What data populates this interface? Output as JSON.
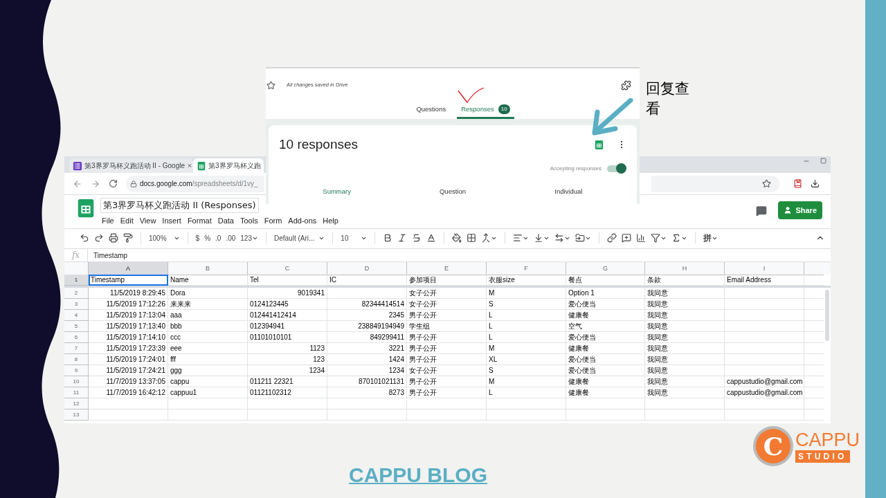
{
  "browser": {
    "tabs": [
      {
        "label": "第3界罗马杯义跑活动 II - Google",
        "kind": "forms",
        "selected": false
      },
      {
        "label": "第3界罗马杯义跑",
        "kind": "sheets",
        "selected": true
      }
    ],
    "url_host": "docs.google.com",
    "url_path": "/spreadsheets/d/1vy_"
  },
  "sheet": {
    "title": "第3界罗马杯义跑活动 II (Responses)",
    "menu": [
      "File",
      "Edit",
      "View",
      "Insert",
      "Format",
      "Data",
      "Tools",
      "Form",
      "Add-ons",
      "Help"
    ],
    "share_label": "Share",
    "toolbar": {
      "zoom": "100%",
      "currency": "$",
      "percent": "%",
      "decrease_decimals": ".0",
      "increase_decimals": ".00",
      "more_formats": "123",
      "font": "Default (Ari...",
      "font_size": "10",
      "input_tools": "拼"
    },
    "formula": {
      "fx": "fx",
      "value": "Timestamp"
    },
    "columns": [
      {
        "letter": "A",
        "selected": true
      },
      {
        "letter": "B",
        "selected": false
      },
      {
        "letter": "C",
        "selected": false
      },
      {
        "letter": "D",
        "selected": false
      },
      {
        "letter": "E",
        "selected": false
      },
      {
        "letter": "F",
        "selected": false
      },
      {
        "letter": "G",
        "selected": false
      },
      {
        "letter": "H",
        "selected": false
      },
      {
        "letter": "I",
        "selected": false
      }
    ],
    "rows": [
      {
        "number": "1",
        "selected": true,
        "cells": [
          {
            "text": "Timestamp",
            "right_aligned": false
          },
          {
            "text": "Name",
            "right_aligned": false
          },
          {
            "text": "Tel",
            "right_aligned": false
          },
          {
            "text": "IC",
            "right_aligned": false
          },
          {
            "text": "参加项目",
            "right_aligned": false
          },
          {
            "text": "衣服size",
            "right_aligned": false
          },
          {
            "text": "餐点",
            "right_aligned": false
          },
          {
            "text": "条款",
            "right_aligned": false
          },
          {
            "text": "Email Address",
            "right_aligned": false
          }
        ]
      },
      {
        "number": "2",
        "selected": false,
        "cells": [
          {
            "text": "11/5/2019 8:29:45",
            "right_aligned": true
          },
          {
            "text": "Dora",
            "right_aligned": false
          },
          {
            "text": "9019341",
            "right_aligned": true
          },
          null,
          {
            "text": "女子公开",
            "right_aligned": false
          },
          {
            "text": "M",
            "right_aligned": false
          },
          {
            "text": "Option 1",
            "right_aligned": false
          },
          {
            "text": "我同意",
            "right_aligned": false
          },
          null
        ]
      },
      {
        "number": "3",
        "selected": false,
        "cells": [
          {
            "text": "11/5/2019 17:12:26",
            "right_aligned": true
          },
          {
            "text": "来来来",
            "right_aligned": false
          },
          {
            "text": "0124123445",
            "right_aligned": false
          },
          {
            "text": "82344414514",
            "right_aligned": true
          },
          {
            "text": "女子公开",
            "right_aligned": false
          },
          {
            "text": "S",
            "right_aligned": false
          },
          {
            "text": "爱心便当",
            "right_aligned": false
          },
          {
            "text": "我同意",
            "right_aligned": false
          },
          null
        ]
      },
      {
        "number": "4",
        "selected": false,
        "cells": [
          {
            "text": "11/5/2019 17:13:04",
            "right_aligned": true
          },
          {
            "text": "aaa",
            "right_aligned": false
          },
          {
            "text": "012441412414",
            "right_aligned": false
          },
          {
            "text": "2345",
            "right_aligned": true
          },
          {
            "text": "男子公开",
            "right_aligned": false
          },
          {
            "text": "L",
            "right_aligned": false
          },
          {
            "text": "健康餐",
            "right_aligned": false
          },
          {
            "text": "我同意",
            "right_aligned": false
          },
          null
        ]
      },
      {
        "number": "5",
        "selected": false,
        "cells": [
          {
            "text": "11/5/2019 17:13:40",
            "right_aligned": true
          },
          {
            "text": "bbb",
            "right_aligned": false
          },
          {
            "text": "012394941",
            "right_aligned": false
          },
          {
            "text": "238849194949",
            "right_aligned": true
          },
          {
            "text": "学生组",
            "right_aligned": false
          },
          {
            "text": "L",
            "right_aligned": false
          },
          {
            "text": "空气",
            "right_aligned": false
          },
          {
            "text": "我同意",
            "right_aligned": false
          },
          null
        ]
      },
      {
        "number": "6",
        "selected": false,
        "cells": [
          {
            "text": "11/5/2019 17:14:10",
            "right_aligned": true
          },
          {
            "text": "ccc",
            "right_aligned": false
          },
          {
            "text": "01101010101",
            "right_aligned": false
          },
          {
            "text": "849299411",
            "right_aligned": true
          },
          {
            "text": "男子公开",
            "right_aligned": false
          },
          {
            "text": "L",
            "right_aligned": false
          },
          {
            "text": "爱心便当",
            "right_aligned": false
          },
          {
            "text": "我同意",
            "right_aligned": false
          },
          null
        ]
      },
      {
        "number": "7",
        "selected": false,
        "cells": [
          {
            "text": "11/5/2019 17:23:39",
            "right_aligned": true
          },
          {
            "text": "eee",
            "right_aligned": false
          },
          {
            "text": "1123",
            "right_aligned": true
          },
          {
            "text": "3221",
            "right_aligned": true
          },
          {
            "text": "男子公开",
            "right_aligned": false
          },
          {
            "text": "M",
            "right_aligned": false
          },
          {
            "text": "健康餐",
            "right_aligned": false
          },
          {
            "text": "我同意",
            "right_aligned": false
          },
          null
        ]
      },
      {
        "number": "8",
        "selected": false,
        "cells": [
          {
            "text": "11/5/2019 17:24:01",
            "right_aligned": true
          },
          {
            "text": "fff",
            "right_aligned": false
          },
          {
            "text": "123",
            "right_aligned": true
          },
          {
            "text": "1424",
            "right_aligned": true
          },
          {
            "text": "男子公开",
            "right_aligned": false
          },
          {
            "text": "XL",
            "right_aligned": false
          },
          {
            "text": "爱心便当",
            "right_aligned": false
          },
          {
            "text": "我同意",
            "right_aligned": false
          },
          null
        ]
      },
      {
        "number": "9",
        "selected": false,
        "cells": [
          {
            "text": "11/5/2019 17:24:21",
            "right_aligned": true
          },
          {
            "text": "ggg",
            "right_aligned": false
          },
          {
            "text": "1234",
            "right_aligned": true
          },
          {
            "text": "1234",
            "right_aligned": true
          },
          {
            "text": "女子公开",
            "right_aligned": false
          },
          {
            "text": "S",
            "right_aligned": false
          },
          {
            "text": "爱心便当",
            "right_aligned": false
          },
          {
            "text": "我同意",
            "right_aligned": false
          },
          null
        ]
      },
      {
        "number": "10",
        "selected": false,
        "cells": [
          {
            "text": "11/7/2019 13:37:05",
            "right_aligned": true
          },
          {
            "text": "cappu",
            "right_aligned": false
          },
          {
            "text": "011211 22321",
            "right_aligned": false
          },
          {
            "text": "870101021131",
            "right_aligned": true
          },
          {
            "text": "男子公开",
            "right_aligned": false
          },
          {
            "text": "M",
            "right_aligned": false
          },
          {
            "text": "健康餐",
            "right_aligned": false
          },
          {
            "text": "我同意",
            "right_aligned": false
          },
          {
            "text": "cappustudio@gmail.com",
            "right_aligned": false
          }
        ]
      },
      {
        "number": "11",
        "selected": false,
        "cells": [
          {
            "text": "11/7/2019 16:42:12",
            "right_aligned": true
          },
          {
            "text": "cappuu1",
            "right_aligned": false
          },
          {
            "text": "01121102312",
            "right_aligned": false
          },
          {
            "text": "8273",
            "right_aligned": true
          },
          {
            "text": "男子公开",
            "right_aligned": false
          },
          {
            "text": "L",
            "right_aligned": false
          },
          {
            "text": "健康餐",
            "right_aligned": false
          },
          {
            "text": "我同意",
            "right_aligned": false
          },
          {
            "text": "cappustudio@gmail.com",
            "right_aligned": false
          }
        ]
      },
      {
        "number": "12",
        "selected": false,
        "cells": [
          null,
          null,
          null,
          null,
          null,
          null,
          null,
          null,
          null
        ]
      },
      {
        "number": "13",
        "selected": false,
        "cells": [
          null,
          null,
          null,
          null,
          null,
          null,
          null,
          null,
          null
        ]
      }
    ]
  },
  "form": {
    "save_status": "All changes saved in Drive",
    "tabs": [
      {
        "label": "Questions",
        "selected": false
      },
      {
        "label": "Responses",
        "selected": true,
        "badge": "10"
      }
    ],
    "heading": "10 responses",
    "accepting_label": "Accepting responses",
    "accepting": true,
    "views": [
      {
        "label": "Summary",
        "selected": true
      },
      {
        "label": "Question",
        "selected": false
      },
      {
        "label": "Individual",
        "selected": false
      }
    ]
  },
  "annotation": "回复查看",
  "footer_link": "CAPPU BLOG",
  "logo": {
    "letter": "C",
    "name": "CAPPU",
    "tagline": "STUDIO"
  }
}
